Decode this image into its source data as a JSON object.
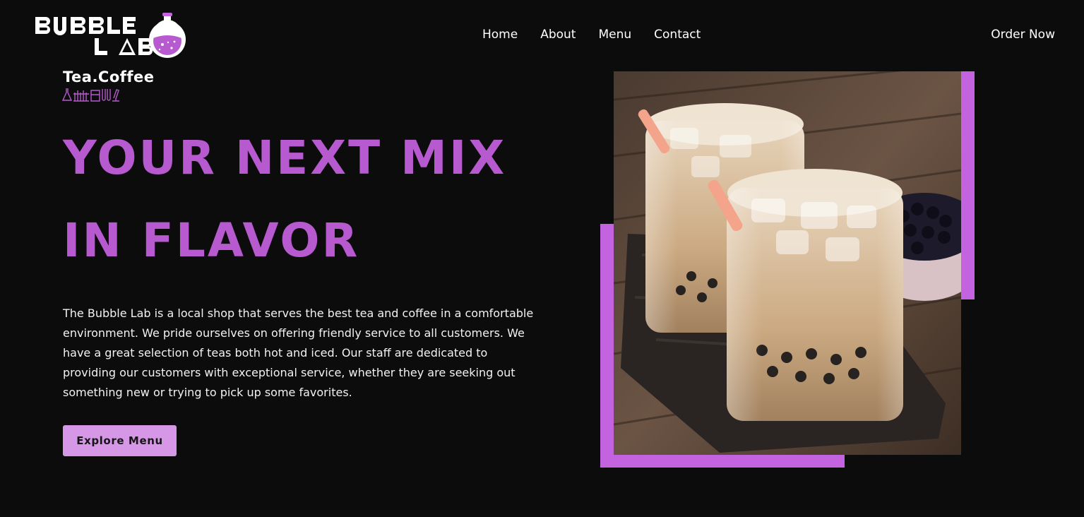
{
  "brand": {
    "logo_text": "BUBBLE LAB",
    "logo_line1": "BUBBLE",
    "logo_line2": "LAB",
    "logo_icon": "flask-icon"
  },
  "nav": {
    "items": [
      {
        "label": "Home"
      },
      {
        "label": "About"
      },
      {
        "label": "Menu"
      },
      {
        "label": "Contact"
      }
    ],
    "cta_label": "Order Now"
  },
  "hero": {
    "tagline": "Tea.Coffee",
    "tagline_icons": "lab-equipment-icon",
    "headline_line1": "YOUR NEXT MIX",
    "headline_line2": "IN FLAVOR",
    "description": "The Bubble Lab is a local shop that serves the best tea and coffee in a comfortable environment. We pride ourselves on offering friendly service to all customers. We have a great selection of teas both hot and iced. Our staff are dedicated to providing our customers with exceptional service, whether they are seeking out something new or trying to pick up some favorites.",
    "button_label": "Explore Menu",
    "image_alt": "Two glasses of iced bubble milk tea with pink straws and a bowl of tapioca pearls"
  },
  "colors": {
    "background": "#0c0c0d",
    "accent": "#b85acf",
    "frame": "#c363df",
    "button": "#d597e6",
    "text": "#ffffff"
  }
}
